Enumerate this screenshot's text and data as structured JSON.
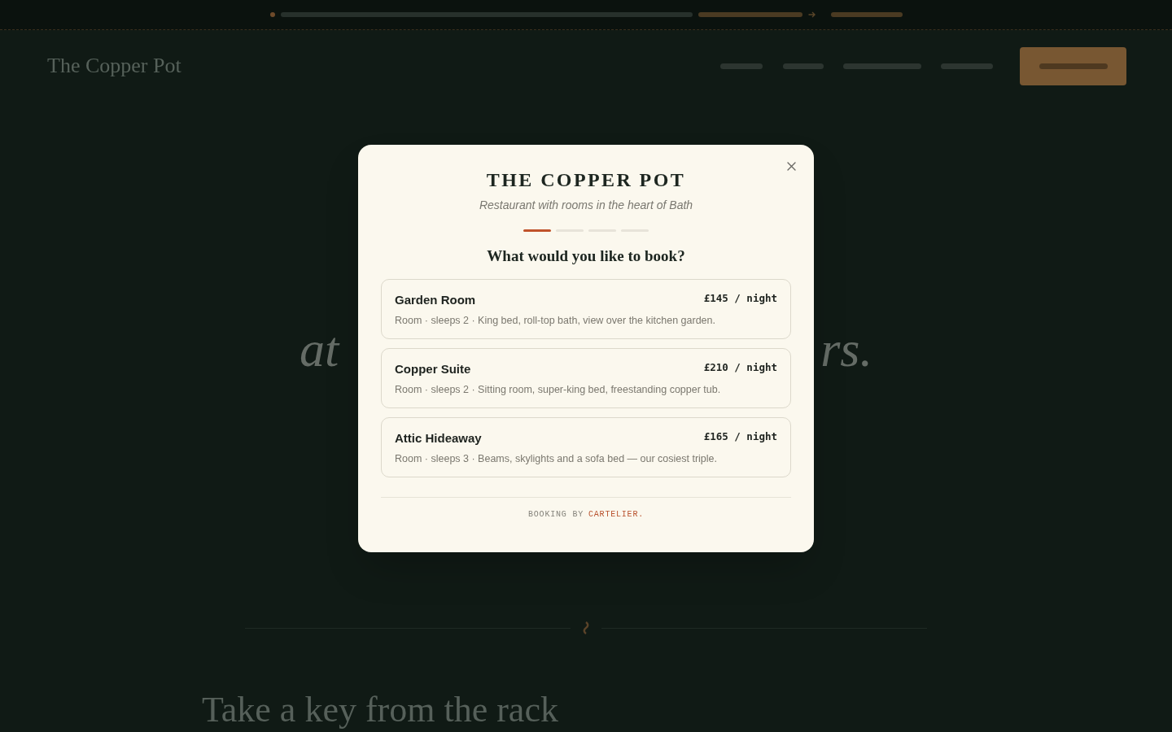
{
  "site_header": {
    "logo": "The Copper Pot"
  },
  "hero": {
    "heading_fragments": [
      "at",
      "rs."
    ]
  },
  "rooms_section": {
    "heading": "Take a key from the rack"
  },
  "booking_modal": {
    "title": "THE COPPER POT",
    "subtitle": "Restaurant with rooms in the heart of Bath",
    "steps": [
      {
        "current": true
      },
      {
        "current": false
      },
      {
        "current": false
      },
      {
        "current": false
      }
    ],
    "question": "What would you like to book?",
    "options": [
      {
        "name": "Garden Room",
        "price": "£145 / night",
        "details": "Room · sleeps 2 · King bed, roll-top bath, view over the kitchen garden."
      },
      {
        "name": "Copper Suite",
        "price": "£210 / night",
        "details": "Room · sleeps 2 · Sitting room, super-king bed, freestanding copper tub."
      },
      {
        "name": "Attic Hideaway",
        "price": "£165 / night",
        "details": "Room · sleeps 3 · Beams, skylights and a sofa bed — our cosiest triple."
      }
    ],
    "footer": {
      "label": "BOOKING BY",
      "brand": "CARTELIER."
    }
  }
}
